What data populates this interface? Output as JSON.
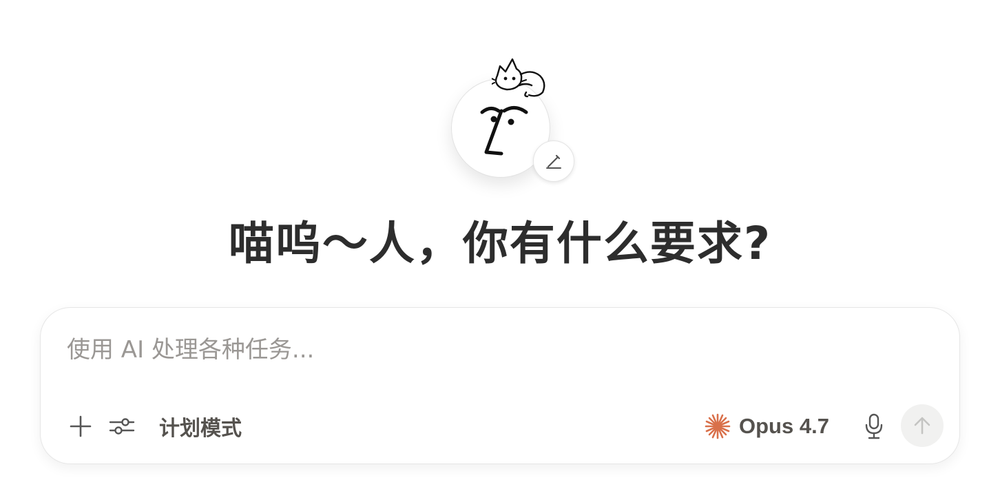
{
  "header": {
    "greeting": "喵呜～人，你有什么要求?"
  },
  "icons": {
    "avatar": "face-doodle-icon",
    "cat": "cat-doodle-icon",
    "edit": "pencil-icon",
    "add": "plus-icon",
    "settings": "sliders-icon",
    "model": "sparkle-icon",
    "mic": "microphone-icon",
    "send": "arrow-up-icon"
  },
  "composer": {
    "placeholder": "使用 AI 处理各种任务...",
    "value": "",
    "plan_mode_label": "计划模式",
    "model_label": "Opus 4.7"
  },
  "colors": {
    "accent": "#d9704a",
    "text": "#2d2d2d",
    "muted": "#9a9794"
  }
}
